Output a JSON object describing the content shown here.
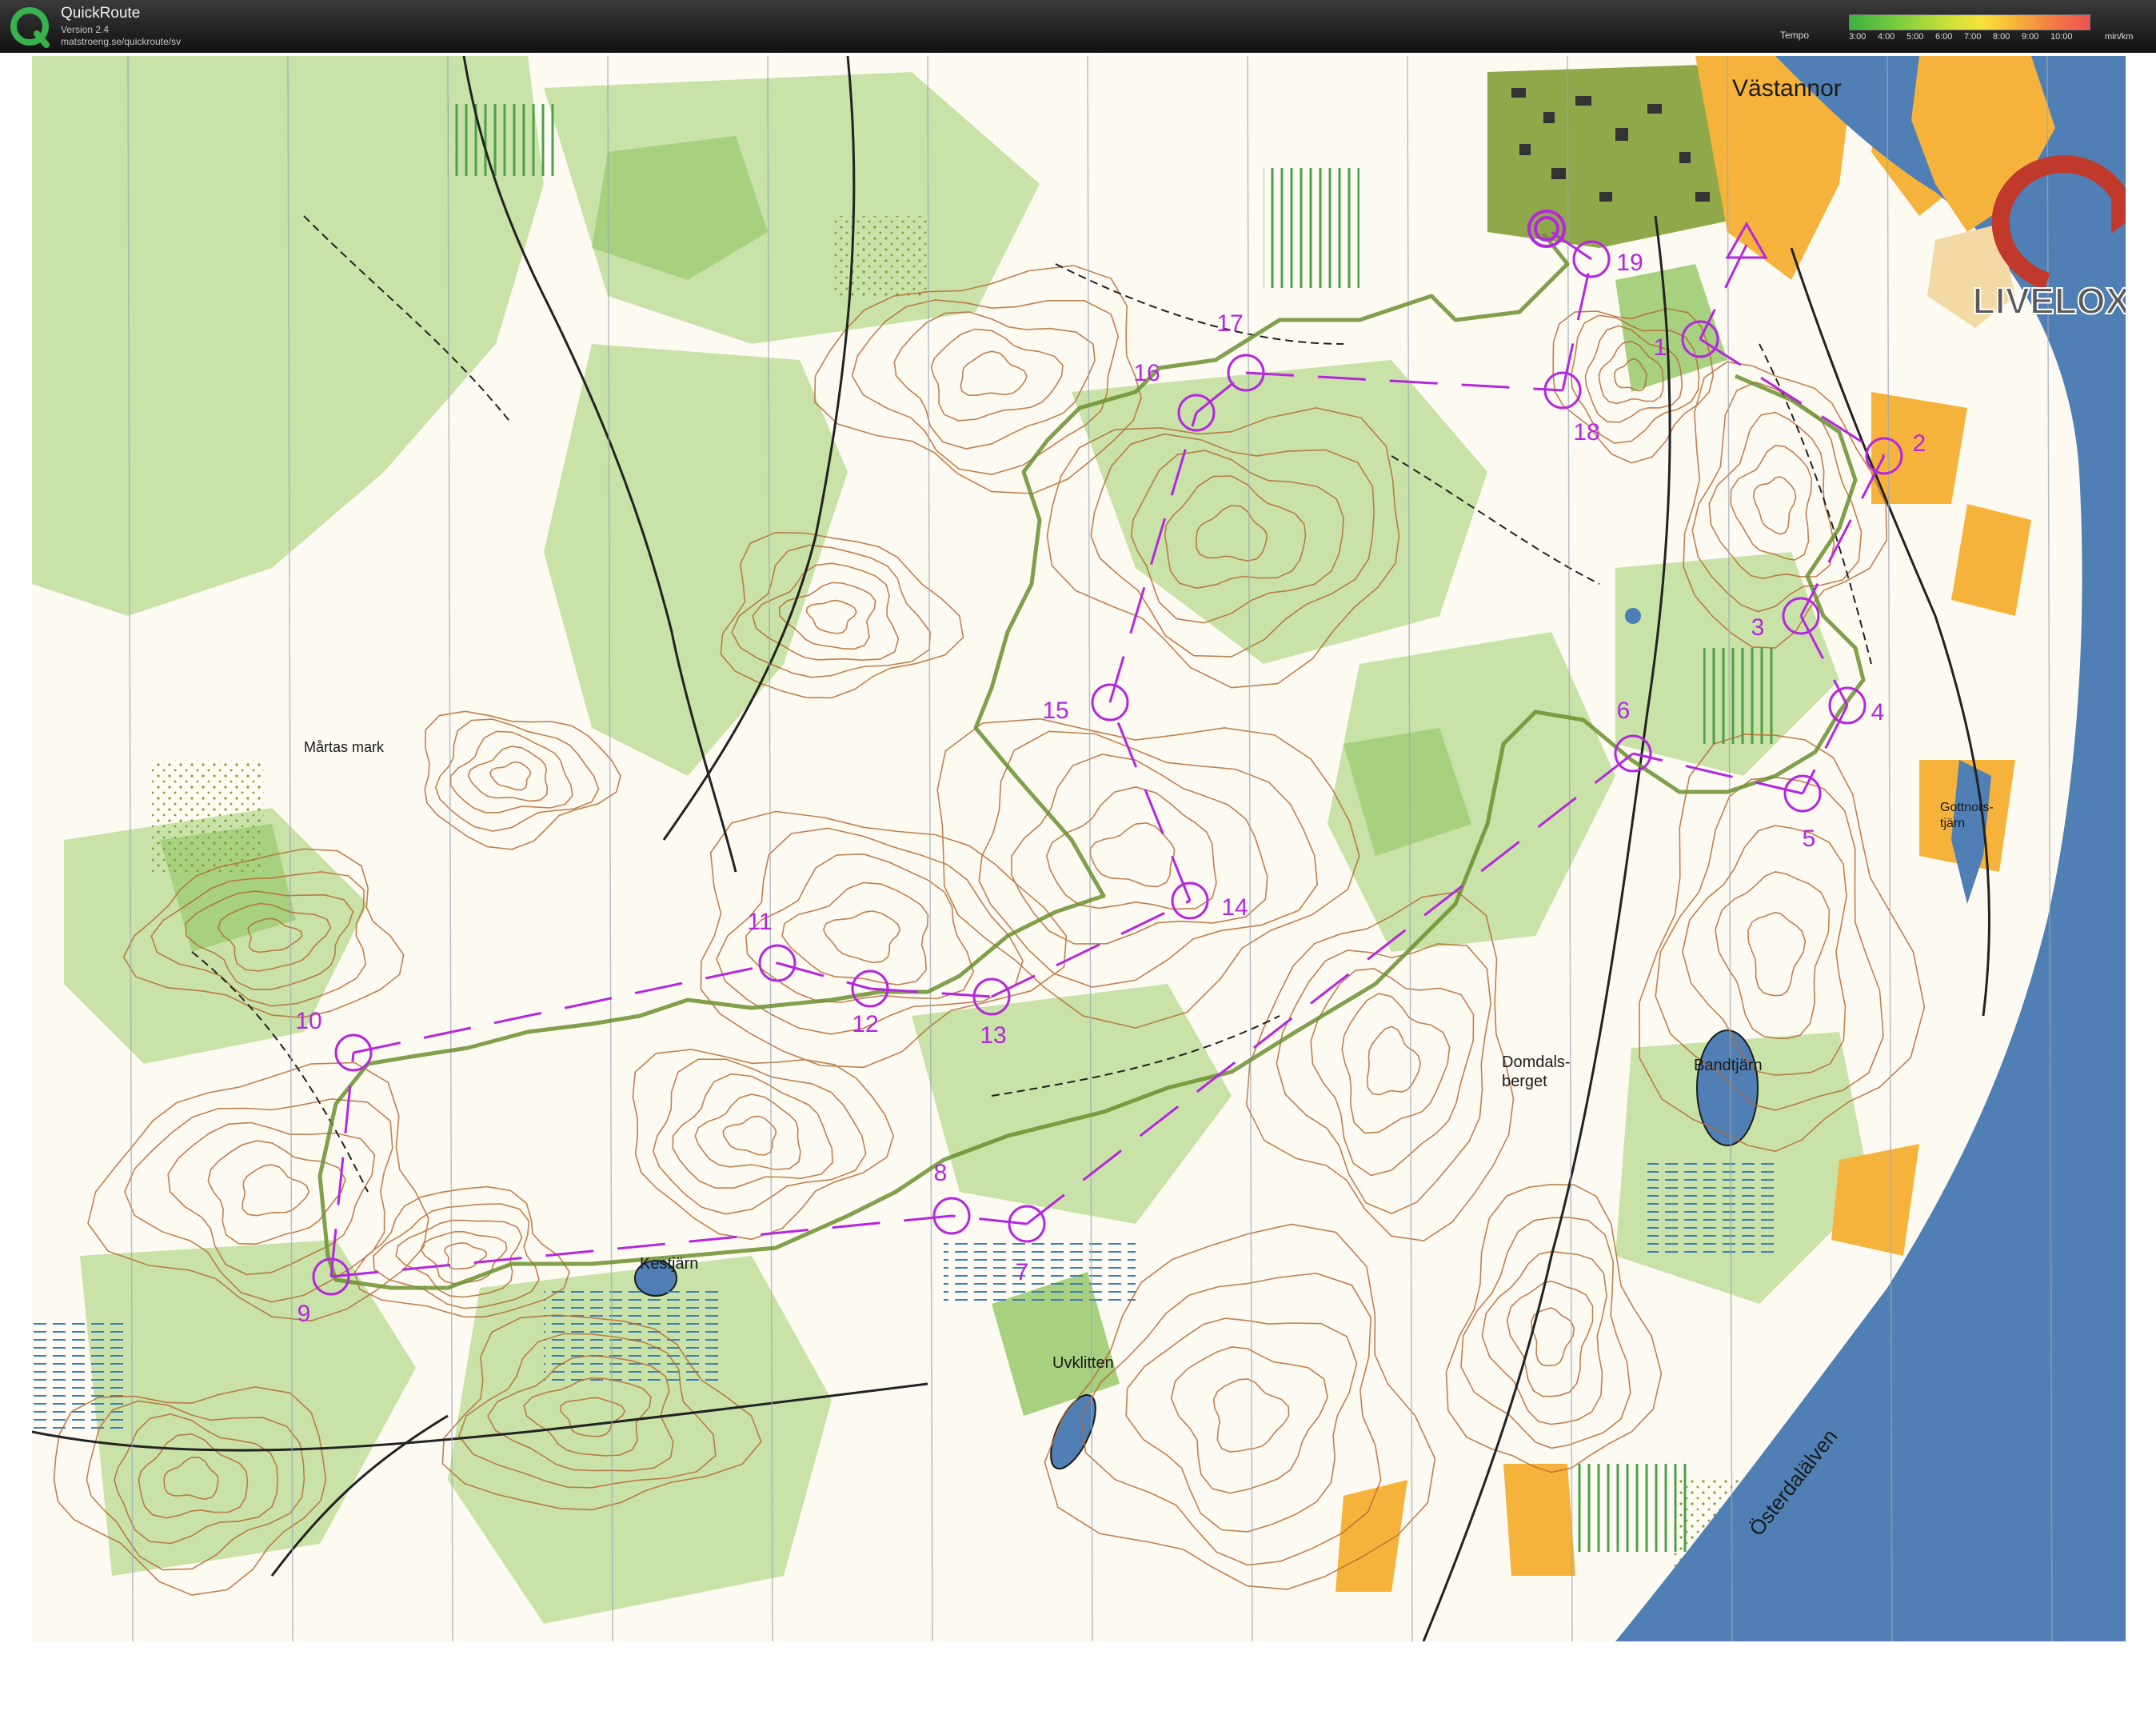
{
  "app": {
    "name": "QuickRoute",
    "version": "Version 2.4",
    "url": "matstroeng.se/quickroute/sv"
  },
  "tempo_legend": {
    "label": "Tempo",
    "ticks": [
      "3:00",
      "4:00",
      "5:00",
      "6:00",
      "7:00",
      "8:00",
      "9:00",
      "10:00"
    ],
    "unit": "min/km"
  },
  "brand": {
    "text": "LIVELOX"
  },
  "colors": {
    "course_purple": "#b526e0",
    "route_line": "#5a7a2a",
    "water": "#4f7fb4",
    "open_land": "#f6b33c",
    "forest_green": "#c7e0a6",
    "contour": "#b76b33"
  },
  "place_names": [
    {
      "id": "vastannor",
      "text": "Västannor"
    },
    {
      "id": "martas",
      "text": "Mårtas mark"
    },
    {
      "id": "domdals",
      "text": "Domdals-\nberget"
    },
    {
      "id": "bandtjarn",
      "text": "Bandtjärn"
    },
    {
      "id": "kestjarn",
      "text": "Kestjärn"
    },
    {
      "id": "uvklitten",
      "text": "Uvklitten"
    },
    {
      "id": "gottnorstjarn",
      "text": "Gottnors-\ntjärn"
    },
    {
      "id": "osterdalalven",
      "text": "Österdalälven"
    }
  ],
  "course": {
    "start_label": "",
    "controls": [
      {
        "number": "1"
      },
      {
        "number": "2"
      },
      {
        "number": "3"
      },
      {
        "number": "4"
      },
      {
        "number": "5"
      },
      {
        "number": "6"
      },
      {
        "number": "7"
      },
      {
        "number": "8"
      },
      {
        "number": "9"
      },
      {
        "number": "10"
      },
      {
        "number": "11"
      },
      {
        "number": "12"
      },
      {
        "number": "13"
      },
      {
        "number": "14"
      },
      {
        "number": "15"
      },
      {
        "number": "16"
      },
      {
        "number": "17"
      },
      {
        "number": "18"
      },
      {
        "number": "19"
      }
    ]
  }
}
